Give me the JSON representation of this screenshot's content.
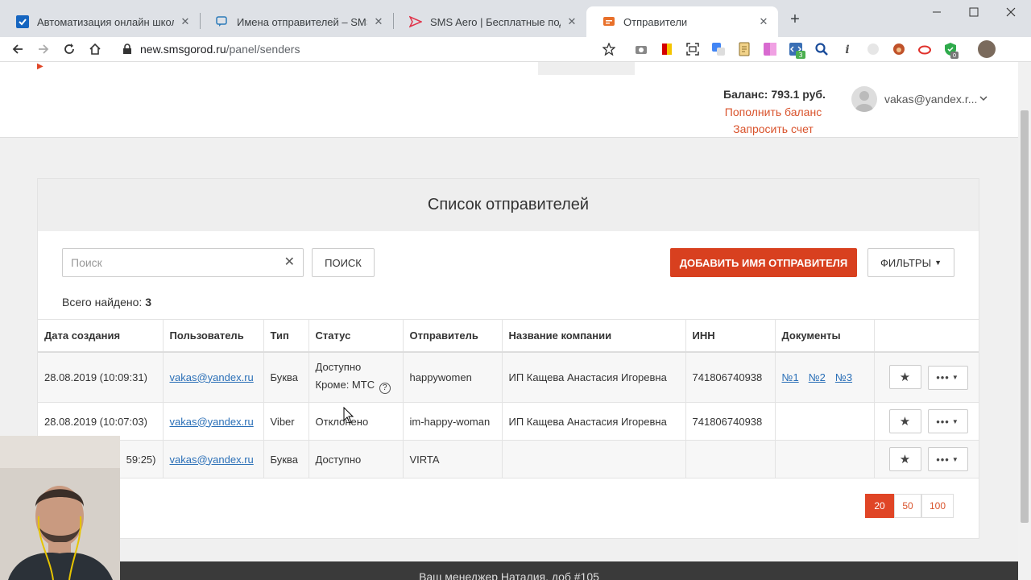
{
  "browser": {
    "tabs": [
      {
        "title": "Автоматизация онлайн школ",
        "icon": "checkmark-favicon"
      },
      {
        "title": "Имена отправителей – SMS-це",
        "icon": "chat-favicon"
      },
      {
        "title": "SMS Aero | Бесплатные подписи",
        "icon": "paper-plane-favicon"
      },
      {
        "title": "Отправители",
        "icon": "message-favicon"
      }
    ],
    "url_host": "new.smsgorod.ru",
    "url_path": "/panel/senders"
  },
  "header": {
    "balance": "Баланс: 793.1 руб.",
    "topup": "Пополнить баланс",
    "invoice": "Запросить счет",
    "user_email": "vakas@yandex.r..."
  },
  "panel": {
    "title": "Список отправителей",
    "search_placeholder": "Поиск",
    "search_button": "ПОИСК",
    "add_button": "ДОБАВИТЬ ИМЯ ОТПРАВИТЕЛЯ",
    "filters_button": "ФИЛЬТРЫ",
    "total_label": "Всего найдено:",
    "total_count": "3"
  },
  "table": {
    "headers": [
      "Дата создания",
      "Пользователь",
      "Тип",
      "Статус",
      "Отправитель",
      "Название компании",
      "ИНН",
      "Документы"
    ],
    "rows": [
      {
        "date": "28.08.2019 (10:09:31)",
        "user": "vakas@yandex.ru",
        "type": "Буква",
        "status": "Доступно",
        "status_note": "Кроме: МТС",
        "sender": "happywomen",
        "company": "ИП Кащева Анастасия Игоревна",
        "inn": "741806740938",
        "docs": [
          "№1",
          "№2",
          "№3"
        ]
      },
      {
        "date": "28.08.2019 (10:07:03)",
        "user": "vakas@yandex.ru",
        "type": "Viber",
        "status": "Отклонено",
        "sender": "im-happy-woman",
        "company": "ИП Кащева Анастасия Игоревна",
        "inn": "741806740938"
      },
      {
        "date": "59:25)",
        "user": "vakas@yandex.ru",
        "type": "Буква",
        "status": "Доступно",
        "sender": "VIRTA",
        "company": "",
        "inn": ""
      }
    ]
  },
  "pager": {
    "sizes": [
      "20",
      "50",
      "100"
    ],
    "active": "20"
  },
  "footer": {
    "text": "Ваш менеджер Наталия, доб #105"
  },
  "colors": {
    "accent": "#e04526",
    "link": "#2a6fb7"
  }
}
